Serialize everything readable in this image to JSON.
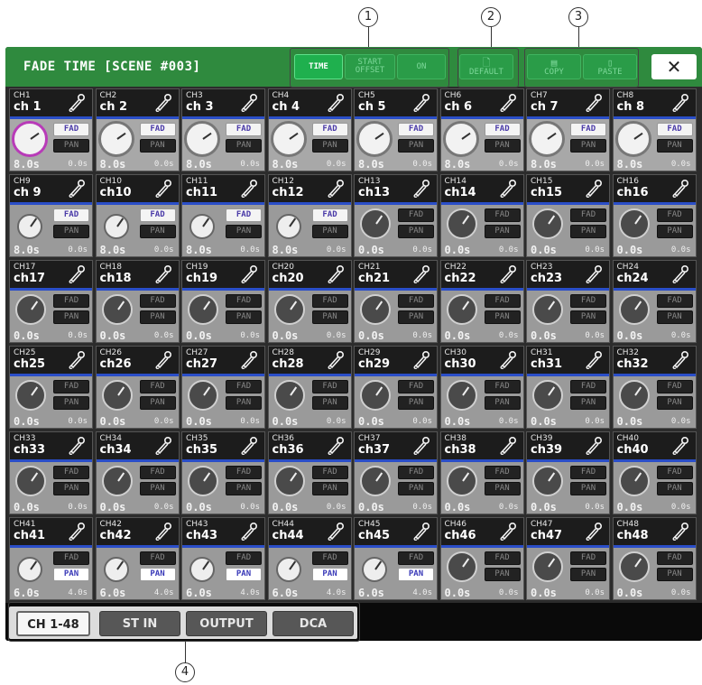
{
  "callouts": [
    "1",
    "2",
    "3",
    "4"
  ],
  "window": {
    "title": "FADE TIME [SCENE #003]",
    "toolbar": {
      "mode_buttons": [
        {
          "label": "TIME",
          "active": true
        },
        {
          "label": "START OFFSET",
          "active": false
        },
        {
          "label": "ON",
          "active": false
        }
      ],
      "default_label": "DEFAULT",
      "copy_label": "COPY",
      "paste_label": "PASTE",
      "close_symbol": "✕"
    },
    "channels": [
      {
        "num": "CH1",
        "name": "ch 1",
        "knob": "large-magenta",
        "fad": true,
        "pan": false,
        "time": "8.0s",
        "offset": "0.0s"
      },
      {
        "num": "CH2",
        "name": "ch 2",
        "knob": "large",
        "fad": true,
        "pan": false,
        "time": "8.0s",
        "offset": "0.0s"
      },
      {
        "num": "CH3",
        "name": "ch 3",
        "knob": "large",
        "fad": true,
        "pan": false,
        "time": "8.0s",
        "offset": "0.0s"
      },
      {
        "num": "CH4",
        "name": "ch 4",
        "knob": "large",
        "fad": true,
        "pan": false,
        "time": "8.0s",
        "offset": "0.0s"
      },
      {
        "num": "CH5",
        "name": "ch 5",
        "knob": "large",
        "fad": true,
        "pan": false,
        "time": "8.0s",
        "offset": "0.0s"
      },
      {
        "num": "CH6",
        "name": "ch 6",
        "knob": "large",
        "fad": true,
        "pan": false,
        "time": "8.0s",
        "offset": "0.0s"
      },
      {
        "num": "CH7",
        "name": "ch 7",
        "knob": "large",
        "fad": true,
        "pan": false,
        "time": "8.0s",
        "offset": "0.0s"
      },
      {
        "num": "CH8",
        "name": "ch 8",
        "knob": "large",
        "fad": true,
        "pan": false,
        "time": "8.0s",
        "offset": "0.0s"
      },
      {
        "num": "CH9",
        "name": "ch 9",
        "knob": "small",
        "fad": true,
        "pan": false,
        "time": "8.0s",
        "offset": "0.0s"
      },
      {
        "num": "CH10",
        "name": "ch10",
        "knob": "small",
        "fad": true,
        "pan": false,
        "time": "8.0s",
        "offset": "0.0s"
      },
      {
        "num": "CH11",
        "name": "ch11",
        "knob": "small",
        "fad": true,
        "pan": false,
        "time": "8.0s",
        "offset": "0.0s"
      },
      {
        "num": "CH12",
        "name": "ch12",
        "knob": "small",
        "fad": true,
        "pan": false,
        "time": "8.0s",
        "offset": "0.0s"
      },
      {
        "num": "CH13",
        "name": "ch13",
        "knob": "dark",
        "fad": false,
        "pan": false,
        "time": "0.0s",
        "offset": "0.0s"
      },
      {
        "num": "CH14",
        "name": "ch14",
        "knob": "dark",
        "fad": false,
        "pan": false,
        "time": "0.0s",
        "offset": "0.0s"
      },
      {
        "num": "CH15",
        "name": "ch15",
        "knob": "dark",
        "fad": false,
        "pan": false,
        "time": "0.0s",
        "offset": "0.0s"
      },
      {
        "num": "CH16",
        "name": "ch16",
        "knob": "dark",
        "fad": false,
        "pan": false,
        "time": "0.0s",
        "offset": "0.0s"
      },
      {
        "num": "CH17",
        "name": "ch17",
        "knob": "dark",
        "fad": false,
        "pan": false,
        "time": "0.0s",
        "offset": "0.0s"
      },
      {
        "num": "CH18",
        "name": "ch18",
        "knob": "dark",
        "fad": false,
        "pan": false,
        "time": "0.0s",
        "offset": "0.0s"
      },
      {
        "num": "CH19",
        "name": "ch19",
        "knob": "dark",
        "fad": false,
        "pan": false,
        "time": "0.0s",
        "offset": "0.0s"
      },
      {
        "num": "CH20",
        "name": "ch20",
        "knob": "dark",
        "fad": false,
        "pan": false,
        "time": "0.0s",
        "offset": "0.0s"
      },
      {
        "num": "CH21",
        "name": "ch21",
        "knob": "dark",
        "fad": false,
        "pan": false,
        "time": "0.0s",
        "offset": "0.0s"
      },
      {
        "num": "CH22",
        "name": "ch22",
        "knob": "dark",
        "fad": false,
        "pan": false,
        "time": "0.0s",
        "offset": "0.0s"
      },
      {
        "num": "CH23",
        "name": "ch23",
        "knob": "dark",
        "fad": false,
        "pan": false,
        "time": "0.0s",
        "offset": "0.0s"
      },
      {
        "num": "CH24",
        "name": "ch24",
        "knob": "dark",
        "fad": false,
        "pan": false,
        "time": "0.0s",
        "offset": "0.0s"
      },
      {
        "num": "CH25",
        "name": "ch25",
        "knob": "dark",
        "fad": false,
        "pan": false,
        "time": "0.0s",
        "offset": "0.0s"
      },
      {
        "num": "CH26",
        "name": "ch26",
        "knob": "dark",
        "fad": false,
        "pan": false,
        "time": "0.0s",
        "offset": "0.0s"
      },
      {
        "num": "CH27",
        "name": "ch27",
        "knob": "dark",
        "fad": false,
        "pan": false,
        "time": "0.0s",
        "offset": "0.0s"
      },
      {
        "num": "CH28",
        "name": "ch28",
        "knob": "dark",
        "fad": false,
        "pan": false,
        "time": "0.0s",
        "offset": "0.0s"
      },
      {
        "num": "CH29",
        "name": "ch29",
        "knob": "dark",
        "fad": false,
        "pan": false,
        "time": "0.0s",
        "offset": "0.0s"
      },
      {
        "num": "CH30",
        "name": "ch30",
        "knob": "dark",
        "fad": false,
        "pan": false,
        "time": "0.0s",
        "offset": "0.0s"
      },
      {
        "num": "CH31",
        "name": "ch31",
        "knob": "dark",
        "fad": false,
        "pan": false,
        "time": "0.0s",
        "offset": "0.0s"
      },
      {
        "num": "CH32",
        "name": "ch32",
        "knob": "dark",
        "fad": false,
        "pan": false,
        "time": "0.0s",
        "offset": "0.0s"
      },
      {
        "num": "CH33",
        "name": "ch33",
        "knob": "dark",
        "fad": false,
        "pan": false,
        "time": "0.0s",
        "offset": "0.0s"
      },
      {
        "num": "CH34",
        "name": "ch34",
        "knob": "dark",
        "fad": false,
        "pan": false,
        "time": "0.0s",
        "offset": "0.0s"
      },
      {
        "num": "CH35",
        "name": "ch35",
        "knob": "dark",
        "fad": false,
        "pan": false,
        "time": "0.0s",
        "offset": "0.0s"
      },
      {
        "num": "CH36",
        "name": "ch36",
        "knob": "dark",
        "fad": false,
        "pan": false,
        "time": "0.0s",
        "offset": "0.0s"
      },
      {
        "num": "CH37",
        "name": "ch37",
        "knob": "dark",
        "fad": false,
        "pan": false,
        "time": "0.0s",
        "offset": "0.0s"
      },
      {
        "num": "CH38",
        "name": "ch38",
        "knob": "dark",
        "fad": false,
        "pan": false,
        "time": "0.0s",
        "offset": "0.0s"
      },
      {
        "num": "CH39",
        "name": "ch39",
        "knob": "dark",
        "fad": false,
        "pan": false,
        "time": "0.0s",
        "offset": "0.0s"
      },
      {
        "num": "CH40",
        "name": "ch40",
        "knob": "dark",
        "fad": false,
        "pan": false,
        "time": "0.0s",
        "offset": "0.0s"
      },
      {
        "num": "CH41",
        "name": "ch41",
        "knob": "small",
        "fad": false,
        "pan": true,
        "time": "6.0s",
        "offset": "4.0s"
      },
      {
        "num": "CH42",
        "name": "ch42",
        "knob": "small",
        "fad": false,
        "pan": true,
        "time": "6.0s",
        "offset": "4.0s"
      },
      {
        "num": "CH43",
        "name": "ch43",
        "knob": "small",
        "fad": false,
        "pan": true,
        "time": "6.0s",
        "offset": "4.0s"
      },
      {
        "num": "CH44",
        "name": "ch44",
        "knob": "small",
        "fad": false,
        "pan": true,
        "time": "6.0s",
        "offset": "4.0s"
      },
      {
        "num": "CH45",
        "name": "ch45",
        "knob": "small",
        "fad": false,
        "pan": true,
        "time": "6.0s",
        "offset": "4.0s"
      },
      {
        "num": "CH46",
        "name": "ch46",
        "knob": "dark",
        "fad": false,
        "pan": false,
        "time": "0.0s",
        "offset": "0.0s"
      },
      {
        "num": "CH47",
        "name": "ch47",
        "knob": "dark",
        "fad": false,
        "pan": false,
        "time": "0.0s",
        "offset": "0.0s"
      },
      {
        "num": "CH48",
        "name": "ch48",
        "knob": "dark",
        "fad": false,
        "pan": false,
        "time": "0.0s",
        "offset": "0.0s"
      }
    ],
    "badge_labels": {
      "fad": "FAD",
      "pan": "PAN"
    },
    "tabs": [
      {
        "label": "CH 1-48",
        "active": true
      },
      {
        "label": "ST IN",
        "active": false
      },
      {
        "label": "OUTPUT",
        "active": false
      },
      {
        "label": "DCA",
        "active": false
      }
    ]
  },
  "colors": {
    "title_green": "#2f8a3e",
    "active_green": "#1fb04e",
    "channel_blue": "#2a4ec8",
    "knob_magenta": "#b83bb8"
  },
  "icons": [
    "microphone-icon",
    "document-icon",
    "copy-icon",
    "paste-icon",
    "close-icon"
  ]
}
